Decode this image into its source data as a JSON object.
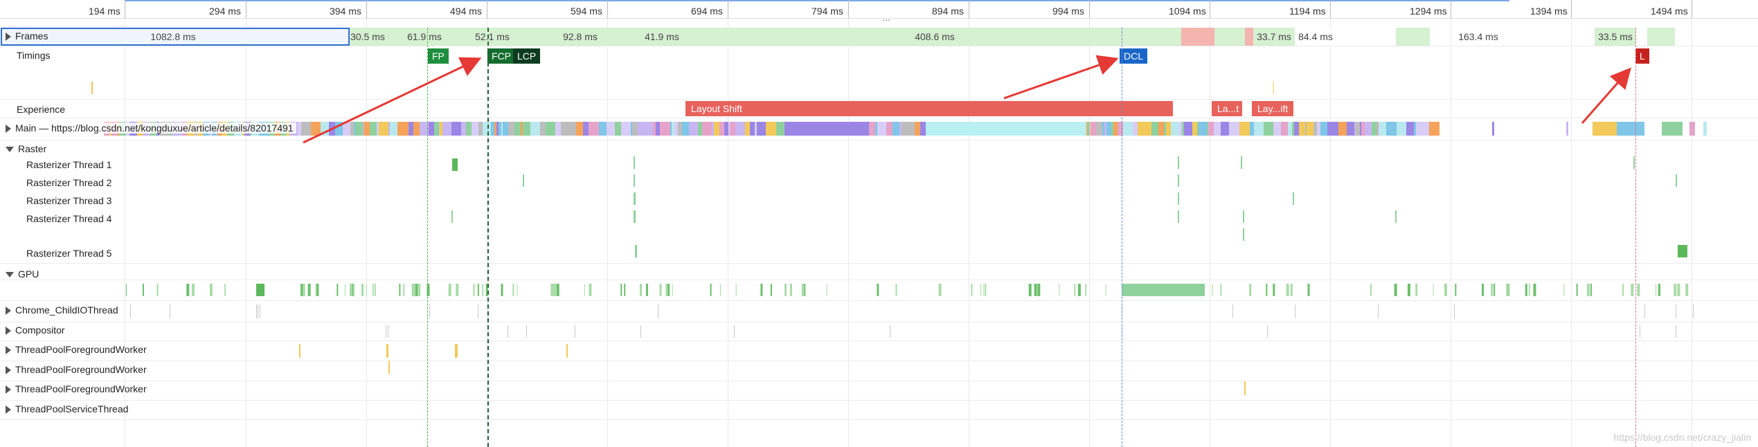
{
  "ruler": {
    "ticks": [
      "194 ms",
      "294 ms",
      "394 ms",
      "494 ms",
      "594 ms",
      "694 ms",
      "794 ms",
      "894 ms",
      "994 ms",
      "1094 ms",
      "1194 ms",
      "1294 ms",
      "1394 ms",
      "1494 ms"
    ]
  },
  "frames": {
    "label": "Frames",
    "segments": [
      "1082.8 ms",
      "30.5 ms",
      "61.9 ms",
      "52.1 ms",
      "92.8 ms",
      "41.9 ms",
      "408.6 ms",
      "33.7 ms",
      "84.4 ms",
      "163.4 ms",
      "33.5 ms"
    ]
  },
  "timings": {
    "label": "Timings",
    "badges": {
      "fp": "FP",
      "fcp": "FCP",
      "lcp": "LCP",
      "dcl": "DCL",
      "l": "L"
    }
  },
  "experience": {
    "label": "Experience",
    "bars": [
      "Layout Shift",
      "La...t",
      "Lay...ift"
    ]
  },
  "main": {
    "label": "Main — https://blog.csdn.net/kongduxue/article/details/82017491"
  },
  "raster": {
    "label": "Raster",
    "threads": [
      "Rasterizer Thread 1",
      "Rasterizer Thread 2",
      "Rasterizer Thread 3",
      "Rasterizer Thread 4",
      "Rasterizer Thread 5"
    ]
  },
  "tracks": {
    "gpu": "GPU",
    "io": "Chrome_ChildIOThread",
    "compositor": "Compositor",
    "pool1": "ThreadPoolForegroundWorker",
    "pool2": "ThreadPoolForegroundWorker",
    "pool3": "ThreadPoolForegroundWorker",
    "service": "ThreadPoolServiceThread"
  },
  "watermark": "https://blog.csdn.net/crazy_jialin",
  "colors": {
    "frame_green": "#d6f0d2",
    "frame_red": "#f4b4b0",
    "fp": "#1e8e3e",
    "fcp": "#146c2e",
    "lcp": "#0d3b1f",
    "dcl": "#1a66c8",
    "load": "#c5221f",
    "layout_shift": "#e8625c",
    "arrow": "#e53935"
  }
}
